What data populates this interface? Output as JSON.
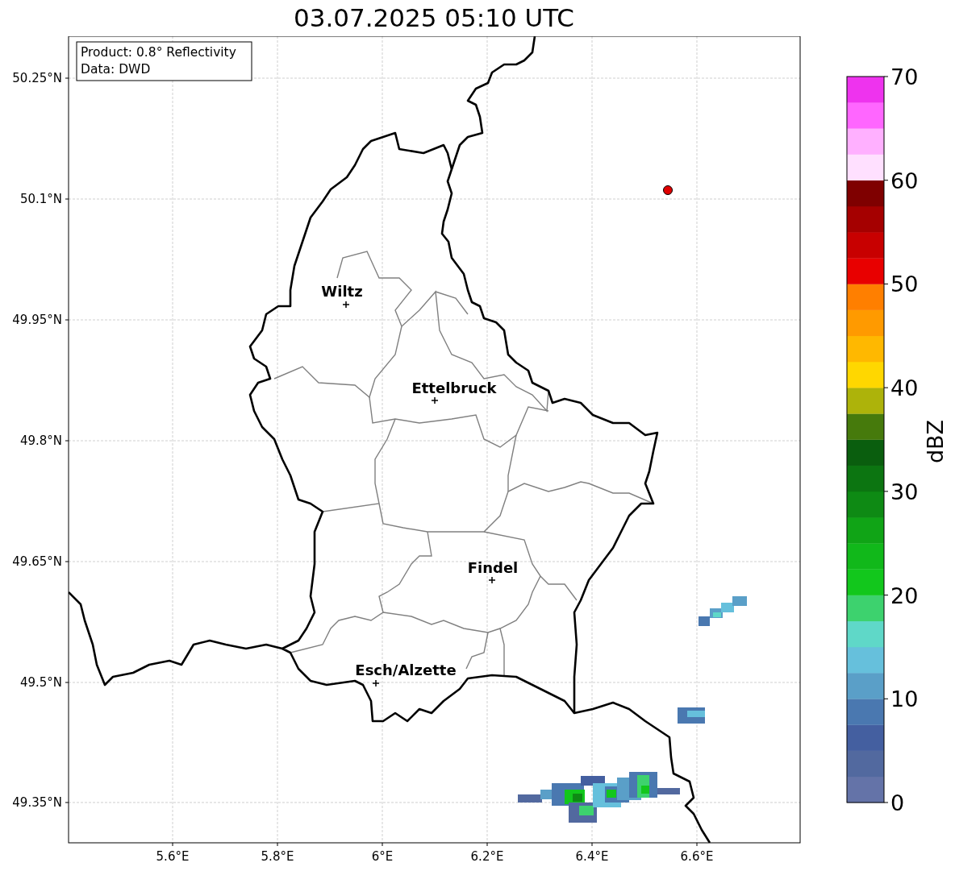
{
  "title": "03.07.2025 05:10 UTC",
  "info_box": {
    "lines": [
      "Product: 0.8° Reflectivity",
      "Data: DWD"
    ]
  },
  "map": {
    "y_ticks": [
      "50.25°N",
      "50.1°N",
      "49.95°N",
      "49.8°N",
      "49.65°N",
      "49.5°N",
      "49.35°N"
    ],
    "x_ticks": [
      "5.6°E",
      "5.8°E",
      "6°E",
      "6.2°E",
      "6.4°E",
      "6.6°E"
    ],
    "cities": [
      {
        "name": "Wiltz"
      },
      {
        "name": "Ettelbruck"
      },
      {
        "name": "Findel"
      },
      {
        "name": "Esch/Alzette"
      }
    ]
  },
  "colorbar": {
    "label": "dBZ",
    "ticks": [
      "70",
      "60",
      "50",
      "40",
      "30",
      "20",
      "10",
      "0"
    ],
    "segments": [
      {
        "color": "#6473a8"
      },
      {
        "color": "#52699f"
      },
      {
        "color": "#445fa0"
      },
      {
        "color": "#4a78b0"
      },
      {
        "color": "#5a9fc8"
      },
      {
        "color": "#66c0dc"
      },
      {
        "color": "#5fd8c8"
      },
      {
        "color": "#3dd26e"
      },
      {
        "color": "#12c71c"
      },
      {
        "color": "#11b81a"
      },
      {
        "color": "#10a416"
      },
      {
        "color": "#0e8a14"
      },
      {
        "color": "#0c7511"
      },
      {
        "color": "#0a5e0e"
      },
      {
        "color": "#467a0c"
      },
      {
        "color": "#adb30a"
      },
      {
        "color": "#ffd700"
      },
      {
        "color": "#ffb800"
      },
      {
        "color": "#ff9a00"
      },
      {
        "color": "#ff7f00"
      },
      {
        "color": "#e80000"
      },
      {
        "color": "#c80000"
      },
      {
        "color": "#a50000"
      },
      {
        "color": "#7f0000"
      },
      {
        "color": "#ffe0ff"
      },
      {
        "color": "#ffb0ff"
      },
      {
        "color": "#ff66ff"
      },
      {
        "color": "#ee33ee"
      }
    ]
  }
}
